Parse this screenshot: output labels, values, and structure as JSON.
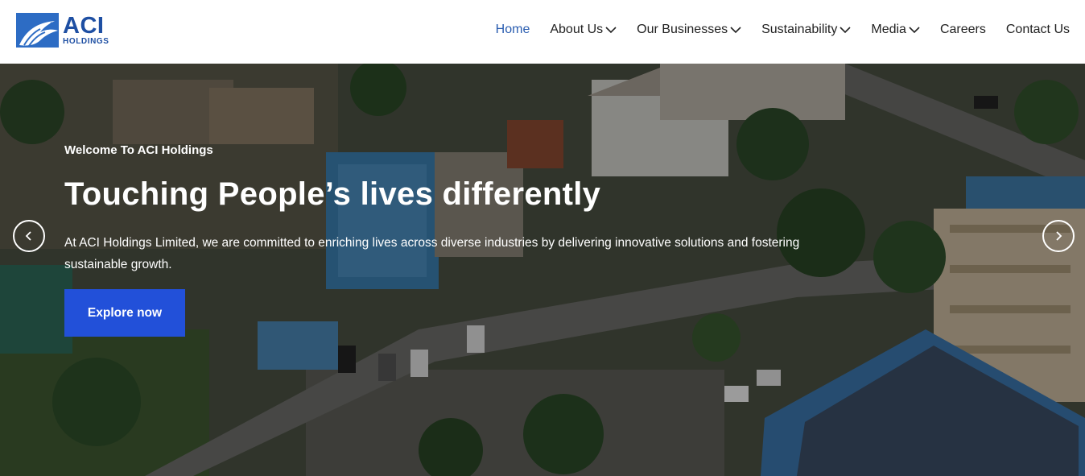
{
  "brand": {
    "name": "ACI",
    "subtitle": "HOLDINGS",
    "icon": "eagle-icon",
    "color": "#1e4fa3"
  },
  "nav": {
    "items": [
      {
        "label": "Home",
        "active": true,
        "dropdown": false
      },
      {
        "label": "About Us",
        "active": false,
        "dropdown": true
      },
      {
        "label": "Our Businesses",
        "active": false,
        "dropdown": true
      },
      {
        "label": "Sustainability",
        "active": false,
        "dropdown": true
      },
      {
        "label": "Media",
        "active": false,
        "dropdown": true
      },
      {
        "label": "Careers",
        "active": false,
        "dropdown": false
      },
      {
        "label": "Contact Us",
        "active": false,
        "dropdown": false
      }
    ]
  },
  "hero": {
    "kicker": "Welcome To ACI Holdings",
    "headline": "Touching People’s lives differently",
    "description": "At ACI Holdings Limited, we are committed to enriching lives across diverse industries by delivering innovative solutions and fostering sustainable growth.",
    "cta_label": "Explore now",
    "cta_color": "#2250d9",
    "prev_icon": "chevron-left-icon",
    "next_icon": "chevron-right-icon"
  }
}
